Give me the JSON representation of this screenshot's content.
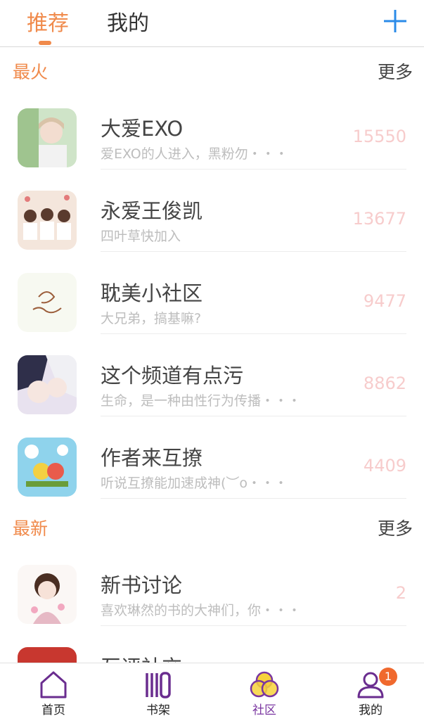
{
  "header": {
    "tabs": [
      {
        "label": "推荐",
        "active": true
      },
      {
        "label": "我的",
        "active": false
      }
    ],
    "add_icon": "plus-icon",
    "accent_color": "#f08a4b"
  },
  "sections": [
    {
      "title": "最火",
      "more_label": "更多",
      "items": [
        {
          "title": "大爱EXO",
          "desc": "爱EXO的人进入，黑粉勿・・・",
          "count": "15550"
        },
        {
          "title": "永爱王俊凯",
          "desc": "四叶草快加入",
          "count": "13677"
        },
        {
          "title": "耽美小社区",
          "desc": "大兄弟，搞基嘛?",
          "count": "9477"
        },
        {
          "title": "这个频道有点污",
          "desc": "生命，是一种由性行为传播・・・",
          "count": "8862"
        },
        {
          "title": "作者来互撩",
          "desc": "听说互撩能加速成神(︶o・・・",
          "count": "4409"
        }
      ]
    },
    {
      "title": "最新",
      "more_label": "更多",
      "items": [
        {
          "title": "新书讨论",
          "desc": "喜欢琳然的书的大神们，你・・・",
          "count": "2"
        },
        {
          "title": "互评社交",
          "desc": "",
          "count": ""
        }
      ]
    }
  ],
  "bottom_nav": [
    {
      "label": "首页",
      "icon": "home-icon",
      "active": false
    },
    {
      "label": "书架",
      "icon": "bookshelf-icon",
      "active": false
    },
    {
      "label": "社区",
      "icon": "community-icon",
      "active": true
    },
    {
      "label": "我的",
      "icon": "profile-icon",
      "active": false,
      "badge": "1"
    }
  ],
  "colors": {
    "accent": "#f08a4b",
    "active_nav": "#7a35a0",
    "count": "#f7cccc",
    "badge": "#f0692e",
    "plus": "#2b8be8"
  }
}
